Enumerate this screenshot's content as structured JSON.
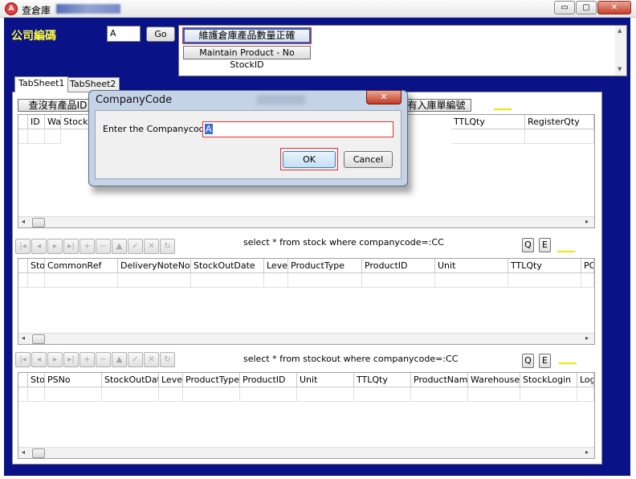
{
  "window": {
    "title": "查倉庫",
    "app_icon": "app-logo-icon",
    "controls": {
      "minimize": "▭",
      "maximize": "▢",
      "close": "✕"
    }
  },
  "header": {
    "company_label": "公司編碼",
    "company_value": "A",
    "go_label": "Go",
    "buttons": {
      "maintain_qty": "維護倉庫產品數量正確",
      "maintain_product": "Maintain Product - No StockID"
    }
  },
  "tabs": [
    {
      "label": "TabSheet1",
      "active": true
    },
    {
      "label": "TabSheet2",
      "active": false
    }
  ],
  "actions": {
    "query_no_product": "查沒有產品ID",
    "import_no": "有入庫單編號"
  },
  "grid1": {
    "columns": [
      "ID",
      "Wa",
      "StockI",
      "TTLQty",
      "RegisterQty"
    ]
  },
  "nav1": {
    "sql": "select * from stock where companycode=:CC",
    "q": "Q",
    "e": "E"
  },
  "grid2": {
    "columns": [
      "Sto",
      "CommonRef",
      "DeliveryNoteNo",
      "StockOutDate",
      "Level",
      "ProductType",
      "ProductID",
      "Unit",
      "TTLQty",
      "PO"
    ]
  },
  "nav2": {
    "sql": "select * from stockout where companycode=:CC",
    "q": "Q",
    "e": "E"
  },
  "grid3": {
    "columns": [
      "Sto",
      "PSNo",
      "StockOutDate",
      "Level",
      "ProductType",
      "ProductID",
      "Unit",
      "TTLQty",
      "ProductName",
      "WarehouseII",
      "StockLogin",
      "Log"
    ]
  },
  "navigator_icons": [
    "first-icon",
    "prior-icon",
    "next-icon",
    "last-icon",
    "insert-icon",
    "delete-icon",
    "edit-icon",
    "post-icon",
    "cancel-icon",
    "refresh-icon"
  ],
  "dialog": {
    "title": "CompanyCode",
    "close": "✕",
    "prompt": "Enter the Companycode!",
    "value": "A",
    "ok": "OK",
    "cancel": "Cancel"
  },
  "colors": {
    "background": "#0a1288",
    "label_yellow": "#ffff3a",
    "close_red": "#c43a22"
  }
}
